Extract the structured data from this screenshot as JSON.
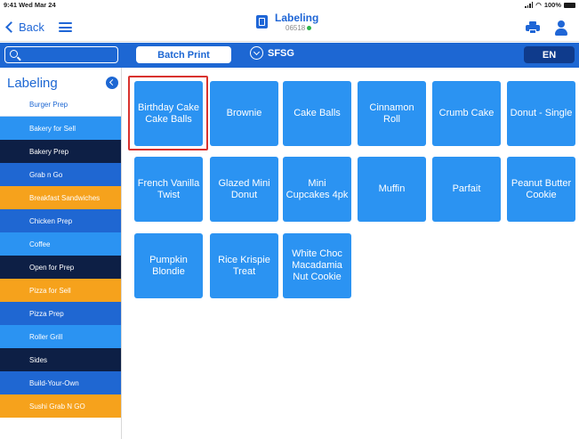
{
  "status_bar": {
    "time": "9:41 Wed Mar 24",
    "battery": "100%"
  },
  "nav": {
    "back_label": "Back",
    "title": "Labeling",
    "store_code": "06518",
    "status_color": "#2db34a"
  },
  "toolbar": {
    "batch_print_label": "Batch Print",
    "store_label": "SFSG",
    "language_label": "EN"
  },
  "sidebar": {
    "title": "Labeling",
    "items": [
      {
        "label": "Burger Prep",
        "style": "white"
      },
      {
        "label": "Bakery for Sell",
        "style": "light-white"
      },
      {
        "label": "Bakery Prep",
        "style": "navy"
      },
      {
        "label": "Grab n Go",
        "style": "blue"
      },
      {
        "label": "Breakfast Sandwiches",
        "style": "orange"
      },
      {
        "label": "Chicken Prep",
        "style": "blue"
      },
      {
        "label": "Coffee",
        "style": "light"
      },
      {
        "label": "Open for Prep",
        "style": "navy"
      },
      {
        "label": "Pizza for Sell",
        "style": "orange"
      },
      {
        "label": "Pizza Prep",
        "style": "blue"
      },
      {
        "label": "Roller Grill",
        "style": "light"
      },
      {
        "label": "Sides",
        "style": "navy"
      },
      {
        "label": "Build-Your-Own",
        "style": "blue"
      },
      {
        "label": "Sushi Grab N GO",
        "style": "orange"
      }
    ]
  },
  "products": [
    "Birthday Cake Cake Balls",
    "Brownie",
    "Cake Balls",
    "Cinnamon Roll",
    "Crumb Cake",
    "Donut - Single",
    "French Vanilla Twist",
    "Glazed Mini Donut",
    "Mini Cupcakes 4pk",
    "Muffin",
    "Parfait",
    "Peanut Butter Cookie",
    "Pumpkin Blondie",
    "Rice Krispie Treat",
    "White Choc Macadamia Nut Cookie"
  ],
  "colors": {
    "accent": "#1d67d3",
    "tile": "#2b93f2",
    "selection": "#d9322e",
    "navy": "#0d1f45",
    "orange": "#f6a21c"
  }
}
